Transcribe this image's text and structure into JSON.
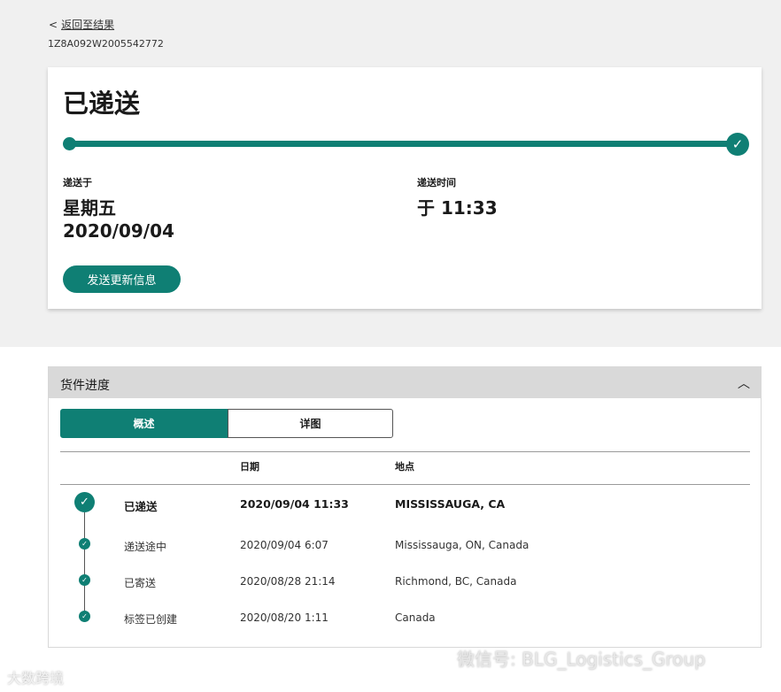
{
  "nav": {
    "back_arrow": "<",
    "back_label": "返回至结果"
  },
  "tracking_number": "1Z8A092W2005542772",
  "status_card": {
    "title": "已递送",
    "progress_percent": 100,
    "delivered_on_label": "递送于",
    "delivered_weekday": "星期五",
    "delivered_date": "2020/09/04",
    "delivery_time_label": "递送时间",
    "delivery_time": "于 11:33",
    "update_button": "发送更新信息"
  },
  "progress_panel": {
    "title": "货件进度",
    "tabs": [
      {
        "label": "概述",
        "active": true
      },
      {
        "label": "详图",
        "active": false
      }
    ],
    "columns": {
      "date": "日期",
      "location": "地点"
    },
    "events": [
      {
        "status": "已递送",
        "datetime": "2020/09/04  11:33",
        "location": "MISSISSAUGA, CA",
        "emphasis": true
      },
      {
        "status": "递送途中",
        "datetime": "2020/09/04  6:07",
        "location": "Mississauga, ON, Canada",
        "emphasis": false
      },
      {
        "status": "已寄送",
        "datetime": "2020/08/28  21:14",
        "location": "Richmond, BC, Canada",
        "emphasis": false
      },
      {
        "status": "标签已创建",
        "datetime": "2020/08/20  1:11",
        "location": "Canada",
        "emphasis": false
      }
    ]
  },
  "watermarks": {
    "wechat": "微信号: BLG_Logistics_Group",
    "brand": "大数跨境"
  },
  "colors": {
    "accent": "#0f7f74",
    "background_top": "#f0f0f0",
    "panel_header": "#d9d9d9"
  },
  "icons": {
    "completed": "check-icon",
    "collapse": "chevron-up-icon"
  }
}
